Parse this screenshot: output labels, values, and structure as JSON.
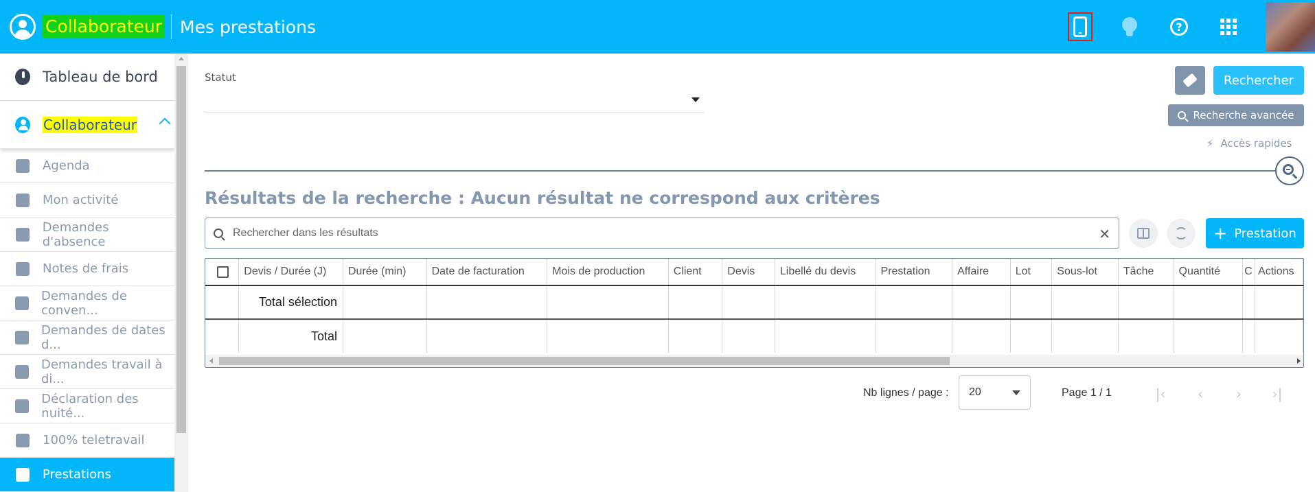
{
  "header": {
    "brand": "Collaborateur",
    "title": "Mes prestations",
    "help_glyph": "?"
  },
  "sidebar": {
    "dashboard": "Tableau de bord",
    "section": "Collaborateur",
    "items": [
      {
        "label": "Agenda",
        "icon": "calendar-clock-icon"
      },
      {
        "label": "Mon activité",
        "icon": "calendar-user-icon"
      },
      {
        "label": "Demandes d'absence",
        "icon": "calendar-x-icon"
      },
      {
        "label": "Notes de frais",
        "icon": "receipt-icon"
      },
      {
        "label": "Demandes de conven...",
        "icon": "chat-icon"
      },
      {
        "label": "Demandes de dates d...",
        "icon": "chat-icon"
      },
      {
        "label": "Demandes travail à di...",
        "icon": "chat-icon"
      },
      {
        "label": "Déclaration des nuité...",
        "icon": "moon-icon"
      },
      {
        "label": "100% teletravail",
        "icon": "badge-icon"
      },
      {
        "label": "Prestations",
        "icon": "hand-icon"
      }
    ],
    "active_item": "Prestations"
  },
  "filters": {
    "statut_label": "Statut",
    "statut_value": "",
    "search_button": "Rechercher",
    "advanced_search": "Recherche avancée",
    "quick_access": "Accès rapides"
  },
  "results": {
    "title": "Résultats de la recherche : Aucun résultat ne correspond aux critères",
    "search_placeholder": "Rechercher dans les résultats",
    "add_button": "Prestation",
    "clear_glyph": "✕",
    "add_glyph": "+"
  },
  "table": {
    "columns": [
      "Devis / Durée (J)",
      "Durée (min)",
      "Date de facturation",
      "Mois de production",
      "Client",
      "Devis",
      "Libellé du devis",
      "Prestation",
      "Affaire",
      "Lot",
      "Sous-lot",
      "Tâche",
      "Quantité",
      "C",
      "Actions"
    ],
    "rows": [
      "Total sélection",
      "Total"
    ]
  },
  "pagination": {
    "rows_per_page_label": "Nb lignes / page :",
    "rows_per_page": "20",
    "page_info": "Page 1 / 1"
  },
  "colors": {
    "accent": "#03b5f9",
    "brand_bg": "#12d11a",
    "brand_text": "#ffff00",
    "muted": "#8a9ab0"
  }
}
